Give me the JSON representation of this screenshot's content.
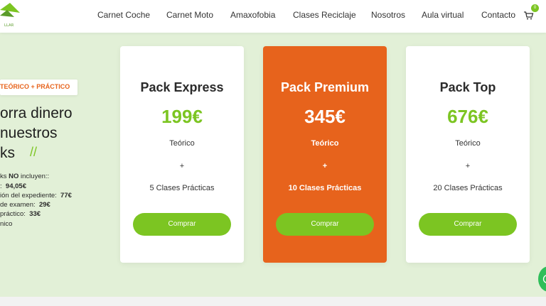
{
  "nav": {
    "items": [
      "Carnet Coche",
      "Carnet Moto",
      "Amaxofobia",
      "Clases Reciclaje",
      "Nosotros",
      "Aula virtual",
      "Contacto"
    ],
    "cart_count": "0",
    "logo_fragment": "LLAR"
  },
  "hero": {
    "tag": "TEÓRICO + PRÁCTICO",
    "lines": [
      "orra dinero",
      " nuestros",
      "ks"
    ],
    "slashes": "//",
    "exclusions": [
      {
        "label": "ks ",
        "bold": "NO",
        "label2": " incluyen::",
        "value": ""
      },
      {
        "label": ":",
        "value": "94,05€"
      },
      {
        "label": "ión del expediente:",
        "value": "77€"
      },
      {
        "label": "de examen:",
        "value": "29€"
      },
      {
        "label": "práctico:",
        "value": "33€"
      },
      {
        "label": "nico",
        "value": ""
      }
    ]
  },
  "cards": [
    {
      "title": "Pack Express",
      "price": "199€",
      "line1": "Teórico",
      "plus": "+",
      "line2": "5 Clases Prácticas",
      "button": "Comprar"
    },
    {
      "title": "Pack Premium",
      "price": "345€",
      "line1": "Teórico",
      "plus": "+",
      "line2": "10 Clases Prácticas",
      "button": "Comprar"
    },
    {
      "title": "Pack Top",
      "price": "676€",
      "line1": "Teórico",
      "plus": "+",
      "line2": "20 Clases Prácticas",
      "button": "Comprar"
    }
  ],
  "colors": {
    "accent_green": "#7cc522",
    "accent_orange": "#e7631c",
    "background": "#e2f0d7"
  },
  "icons": {
    "cart": "shopping-cart-icon",
    "logo": "logo-icon",
    "whatsapp": "whatsapp-icon"
  }
}
